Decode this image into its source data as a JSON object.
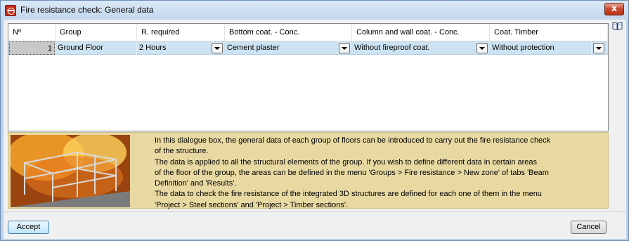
{
  "window": {
    "title": "Fire resistance check: General data",
    "close_glyph": "x"
  },
  "grid": {
    "columns": [
      "Nº",
      "Group",
      "R. required",
      "Bottom coat. - Conc.",
      "Column and wall coat. - Conc.",
      "Coat. Timber"
    ],
    "rows": [
      {
        "num": "1",
        "group": "Ground Floor",
        "r_required": "2 Hours",
        "bottom_coat": "Cement plaster",
        "column_wall_coat": "Without fireproof coat.",
        "coat_timber": "Without protection"
      }
    ]
  },
  "info": {
    "lines": [
      "In this dialogue box, the general data of each group of floors can be introduced to carry out the fire resistance check",
      "of the structure.",
      "The data is applied to all the structural elements of the group. If you wish to define different data in certain areas",
      "of the floor of the group, the areas can be defined in the menu 'Groups > Fire resistance > New zone' of tabs 'Beam",
      "Definition' and 'Results'.",
      "The data to check the fire resistance of the integrated 3D structures are defined for each one of them in the menu",
      "'Project > Steel sections' and 'Project > Timber sections'."
    ]
  },
  "buttons": {
    "accept": "Accept",
    "cancel": "Cancel"
  },
  "icons": {
    "app": "fire-resistance-app-icon",
    "help": "book-help-icon",
    "dropdown": "chevron-down-icon"
  }
}
